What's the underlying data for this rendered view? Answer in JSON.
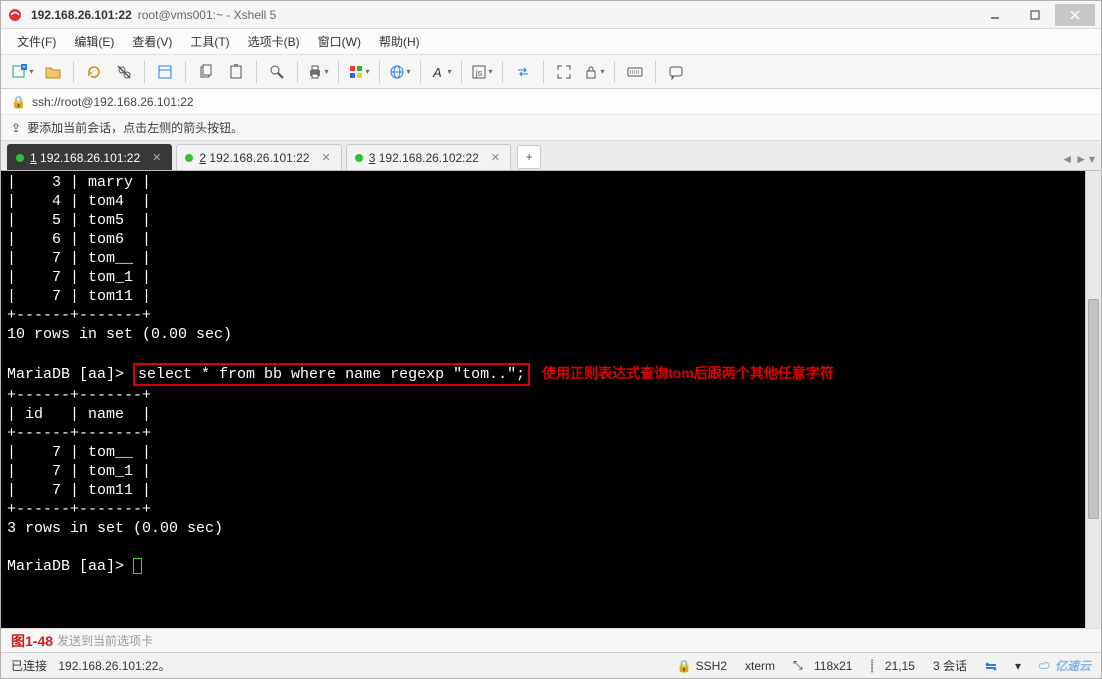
{
  "window": {
    "title_main": "192.168.26.101:22",
    "title_sub": "root@vms001:~ - Xshell 5"
  },
  "menus": {
    "file": "文件(F)",
    "edit": "编辑(E)",
    "view": "查看(V)",
    "tools": "工具(T)",
    "tabs": "选项卡(B)",
    "window": "窗口(W)",
    "help": "帮助(H)"
  },
  "addressbar": {
    "url": "ssh://root@192.168.26.101:22"
  },
  "hintbar": {
    "text": "要添加当前会话，点击左侧的箭头按钮。"
  },
  "tabs": [
    {
      "index": "1",
      "label": "192.168.26.101:22",
      "active": true
    },
    {
      "index": "2",
      "label": "192.168.26.101:22",
      "active": false
    },
    {
      "index": "3",
      "label": "192.168.26.102:22",
      "active": false
    }
  ],
  "terminal": {
    "rows_top": [
      "|    3 | marry |",
      "|    4 | tom4  |",
      "|    5 | tom5  |",
      "|    6 | tom6  |",
      "|    7 | tom__ |",
      "|    7 | tom_1 |",
      "|    7 | tom11 |",
      "+------+-------+",
      "10 rows in set (0.00 sec)",
      ""
    ],
    "prompt1_prefix": "MariaDB [aa]> ",
    "highlight_cmd": "select * from bb where name regexp \"tom..\";",
    "annotation": "使用正则表达式查询tom后跟两个其他任意字符",
    "rows_mid": [
      "+------+-------+",
      "| id   | name  |",
      "+------+-------+",
      "|    7 | tom__ |",
      "|    7 | tom_1 |",
      "|    7 | tom11 |",
      "+------+-------+",
      "3 rows in set (0.00 sec)",
      ""
    ],
    "prompt2": "MariaDB [aa]> "
  },
  "sendhint": {
    "figure_label": "图1-48",
    "text": "发送到当前选项卡"
  },
  "status": {
    "connected": "已连接",
    "host": "192.168.26.101:22。",
    "proto": "SSH2",
    "term": "xterm",
    "size": "118x21",
    "cursor": "21,15",
    "sessions": "3 会话",
    "brand": "亿速云"
  }
}
